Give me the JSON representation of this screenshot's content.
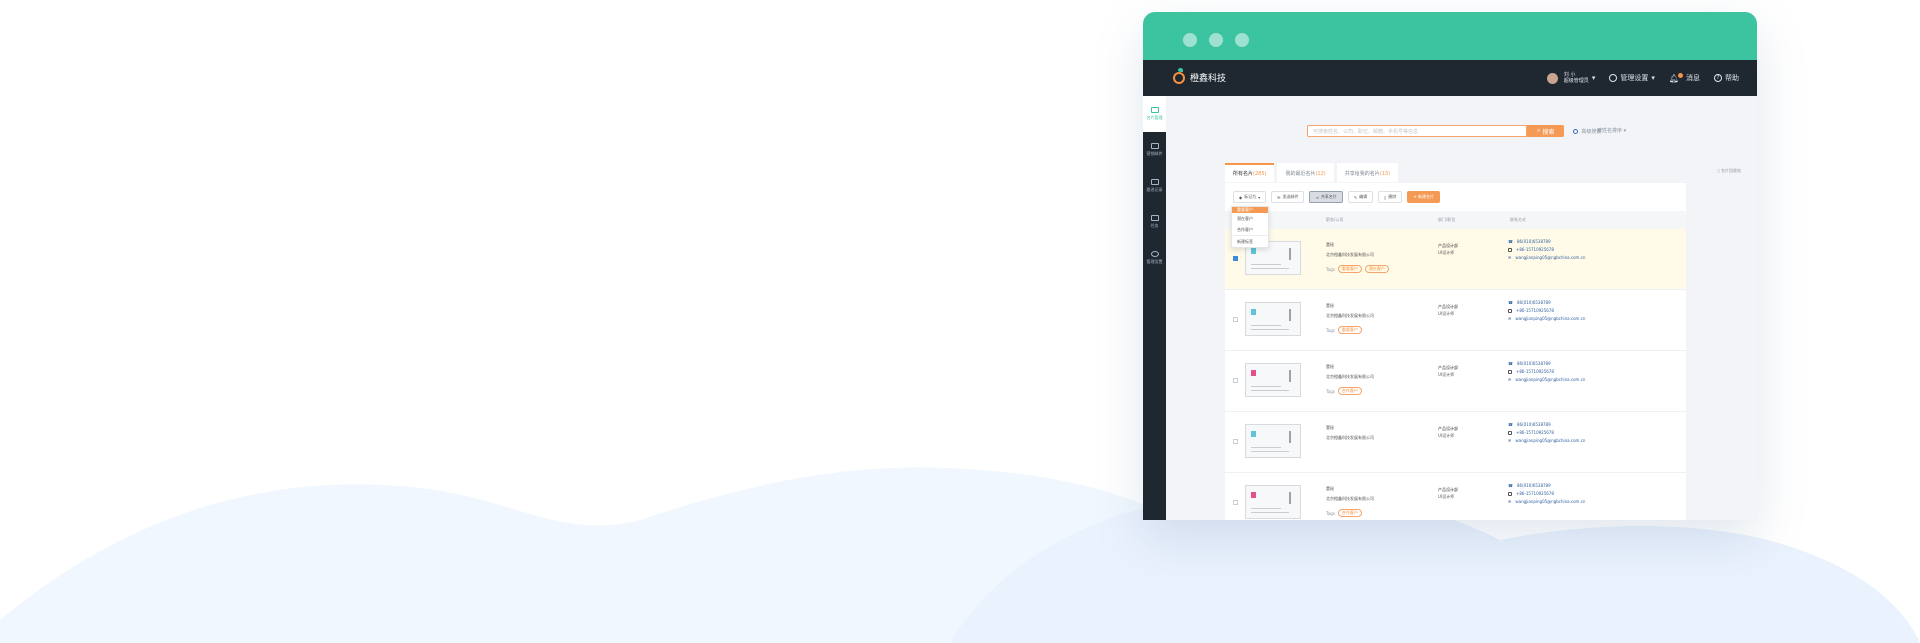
{
  "colors": {
    "accent_green": "#3cc3a0",
    "accent_orange": "#f59545",
    "appbar_dark": "#1f2731"
  },
  "app": {
    "logo_text": "橙鑫科技",
    "user": {
      "name": "刘 小",
      "role": "超级管理员"
    },
    "menu_manage": "管理设置",
    "menu_message": "消息",
    "menu_help": "帮助"
  },
  "sidebar": {
    "items": [
      {
        "label": "名片管理",
        "icon": "card-icon"
      },
      {
        "label": "营销邮件",
        "icon": "mail-icon"
      },
      {
        "label": "跟进记录",
        "icon": "note-icon"
      },
      {
        "label": "任务",
        "icon": "calendar-icon"
      },
      {
        "label": "管理设置",
        "icon": "gear-icon"
      }
    ]
  },
  "search": {
    "placeholder": "可搜索姓名、公司、职位、邮箱、手机号等信息",
    "button_label": "搜索",
    "advanced_label": "高级搜索",
    "sort_label": "按姓名排序"
  },
  "tabs": [
    {
      "label": "所有名片",
      "count": "(285)"
    },
    {
      "label": "我的最近名片",
      "count": "(12)"
    },
    {
      "label": "共享给我的名片",
      "count": "(13)"
    }
  ],
  "export_label": "名片回收站",
  "toolbar": {
    "tag_label": "标记为",
    "send_label": "发送邮件",
    "share_label": "共享名片",
    "edit_label": "编辑",
    "delete_label": "删除",
    "new_label": "+ 新建名片"
  },
  "dropdown": {
    "items": [
      "重要客户",
      "潜在客户",
      "合作客户",
      "新建标签"
    ]
  },
  "table": {
    "columns": [
      "职务/公司",
      "部门/职位",
      "联系方式"
    ],
    "rows": [
      {
        "title": "董秘",
        "company": "北京橙鑫科技发展有限公司",
        "tags_label": "Tags",
        "tags": [
          "重要客户",
          "潜在客户"
        ],
        "dept": "产品设计部",
        "position": "UI设计师",
        "phone": "86(010)6538789",
        "mobile": "+86-15710925678",
        "email": "wangjianping05@ngbchina.com.cn",
        "selected": true
      },
      {
        "title": "董秘",
        "company": "北京橙鑫科技发展有限公司",
        "tags_label": "Tags",
        "tags": [
          "重要客户"
        ],
        "dept": "产品设计部",
        "position": "UI设计师",
        "phone": "86(010)6538789",
        "mobile": "+86-15710925678",
        "email": "wangjianping05@ngbchina.com.cn",
        "selected": false
      },
      {
        "title": "董秘",
        "company": "北京橙鑫科技发展有限公司",
        "tags_label": "Tags",
        "tags": [
          "合作客户"
        ],
        "dept": "产品设计部",
        "position": "UI设计师",
        "phone": "86(010)6538789",
        "mobile": "+86-15710925678",
        "email": "wangjianping05@ngbchina.com.cn",
        "selected": false
      },
      {
        "title": "董秘",
        "company": "北京橙鑫科技发展有限公司",
        "tags_label": "",
        "tags": [],
        "dept": "产品设计部",
        "position": "UI设计师",
        "phone": "86(010)6538789",
        "mobile": "+86-15710925678",
        "email": "wangjianping05@ngbchina.com.cn",
        "selected": false
      },
      {
        "title": "董秘",
        "company": "北京橙鑫科技发展有限公司",
        "tags_label": "Tags",
        "tags": [
          "合作客户"
        ],
        "dept": "产品设计部",
        "position": "UI设计师",
        "phone": "86(010)6538789",
        "mobile": "+86-15710925678",
        "email": "wangjianping05@ngbchina.com.cn",
        "selected": false
      }
    ]
  }
}
